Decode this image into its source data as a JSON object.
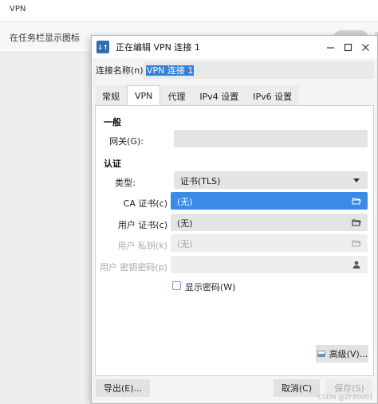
{
  "background": {
    "header": "VPN",
    "row_label": "在任务栏显示图标"
  },
  "dialog": {
    "title": "正在编辑 VPN 连接 1",
    "name_label": "连接名称(n)",
    "name_value": "VPN 连接 1",
    "tabs": [
      {
        "label": "常规"
      },
      {
        "label": "VPN"
      },
      {
        "label": "代理"
      },
      {
        "label": "IPv4 设置"
      },
      {
        "label": "IPv6 设置"
      }
    ],
    "general": {
      "section": "一般",
      "gateway_label": "网关(G):",
      "gateway_value": ""
    },
    "auth": {
      "section": "认证",
      "type_label": "类型:",
      "type_value": "证书(TLS)",
      "ca_label": "CA 证书(c)",
      "ca_value": "(无)",
      "user_cert_label": "用户 证书(c)",
      "user_cert_value": "(无)",
      "user_key_label": "用户 私钥(k)",
      "user_key_value": "(无)",
      "user_key_pw_label": "用户 密钥密码(p)",
      "user_key_pw_value": "",
      "show_password_label": "显示密码(W)"
    },
    "buttons": {
      "advanced": "高级(V)...",
      "export": "导出(E)...",
      "cancel": "取消(C)",
      "save": "保存(S)"
    }
  },
  "watermark": "CSDN @ZFB0001"
}
